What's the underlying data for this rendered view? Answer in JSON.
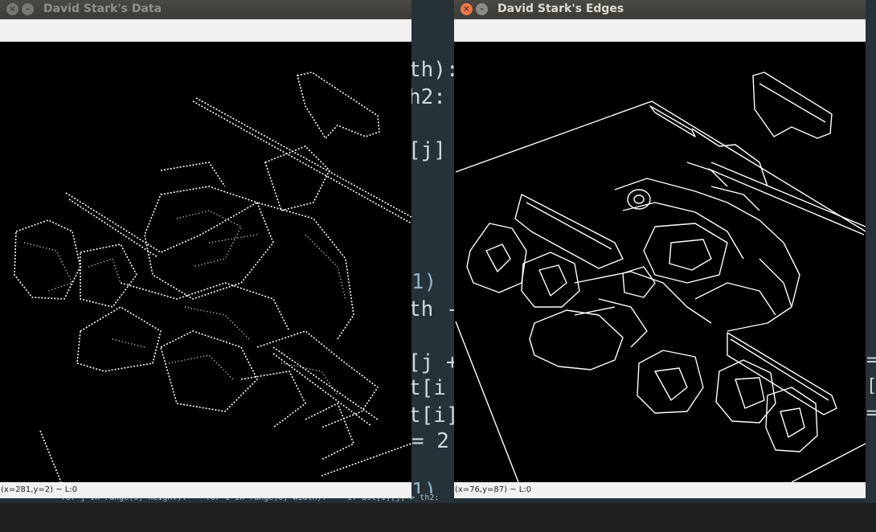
{
  "left_window": {
    "title": "David Stark's Data",
    "status": "(x=281,y=2) ~ L:0"
  },
  "right_window": {
    "title": "David Stark's Edges",
    "status": "(x=76,y=87) ~ L:0"
  },
  "editor": {
    "lines": [
      "th):",
      "h2:",
      "[j]",
      "1)",
      "th -",
      "[j +",
      "t[i",
      "t[i]",
      "= 2",
      "1)"
    ],
    "right_fragments": [
      "=",
      "[",
      "="
    ],
    "bottom_line": [
      "for j in range(0, height):",
      "for i in range(0, width):",
      "if dst[i][j] > th2:"
    ]
  },
  "colors": {
    "edge": "#ffffff",
    "canvas": "#000000",
    "editor_bg": "#263238"
  }
}
